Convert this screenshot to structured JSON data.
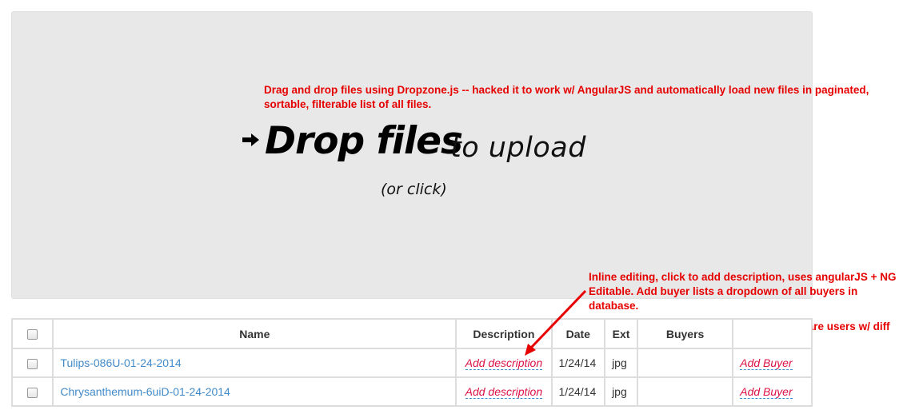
{
  "dropzone": {
    "title": "Drop files",
    "subtitle": "to upload",
    "hint": "(or click)",
    "arrow_icon": "right-arrow-icon"
  },
  "annotations": {
    "dropzone_note": "Drag and drop files using Dropzone.js -- hacked it to work w/ AngularJS and automatically load new files in paginated, sortable, filterable list of all files.",
    "editing_note": "Inline editing, click to add description, uses angularJS + NG Editable. Add buyer lists a dropdown of all buyers in database.",
    "buyers_note": "Note buyers are users w/ diff group/role.",
    "color": "#e60000"
  },
  "table": {
    "headers": {
      "name": "Name",
      "description": "Description",
      "date": "Date",
      "ext": "Ext",
      "buyers": "Buyers"
    },
    "rows": [
      {
        "name": "Tulips-086U-01-24-2014",
        "description": "Add description",
        "date": "1/24/14",
        "ext": "jpg",
        "buyers": "",
        "action": "Add Buyer"
      },
      {
        "name": "Chrysanthemum-6uiD-01-24-2014",
        "description": "Add description",
        "date": "1/24/14",
        "ext": "jpg",
        "buyers": "",
        "action": "Add Buyer"
      }
    ]
  },
  "colors": {
    "link": "#428bca",
    "editable": "#dd1144",
    "dropzone_bg": "#e8e8e8"
  }
}
